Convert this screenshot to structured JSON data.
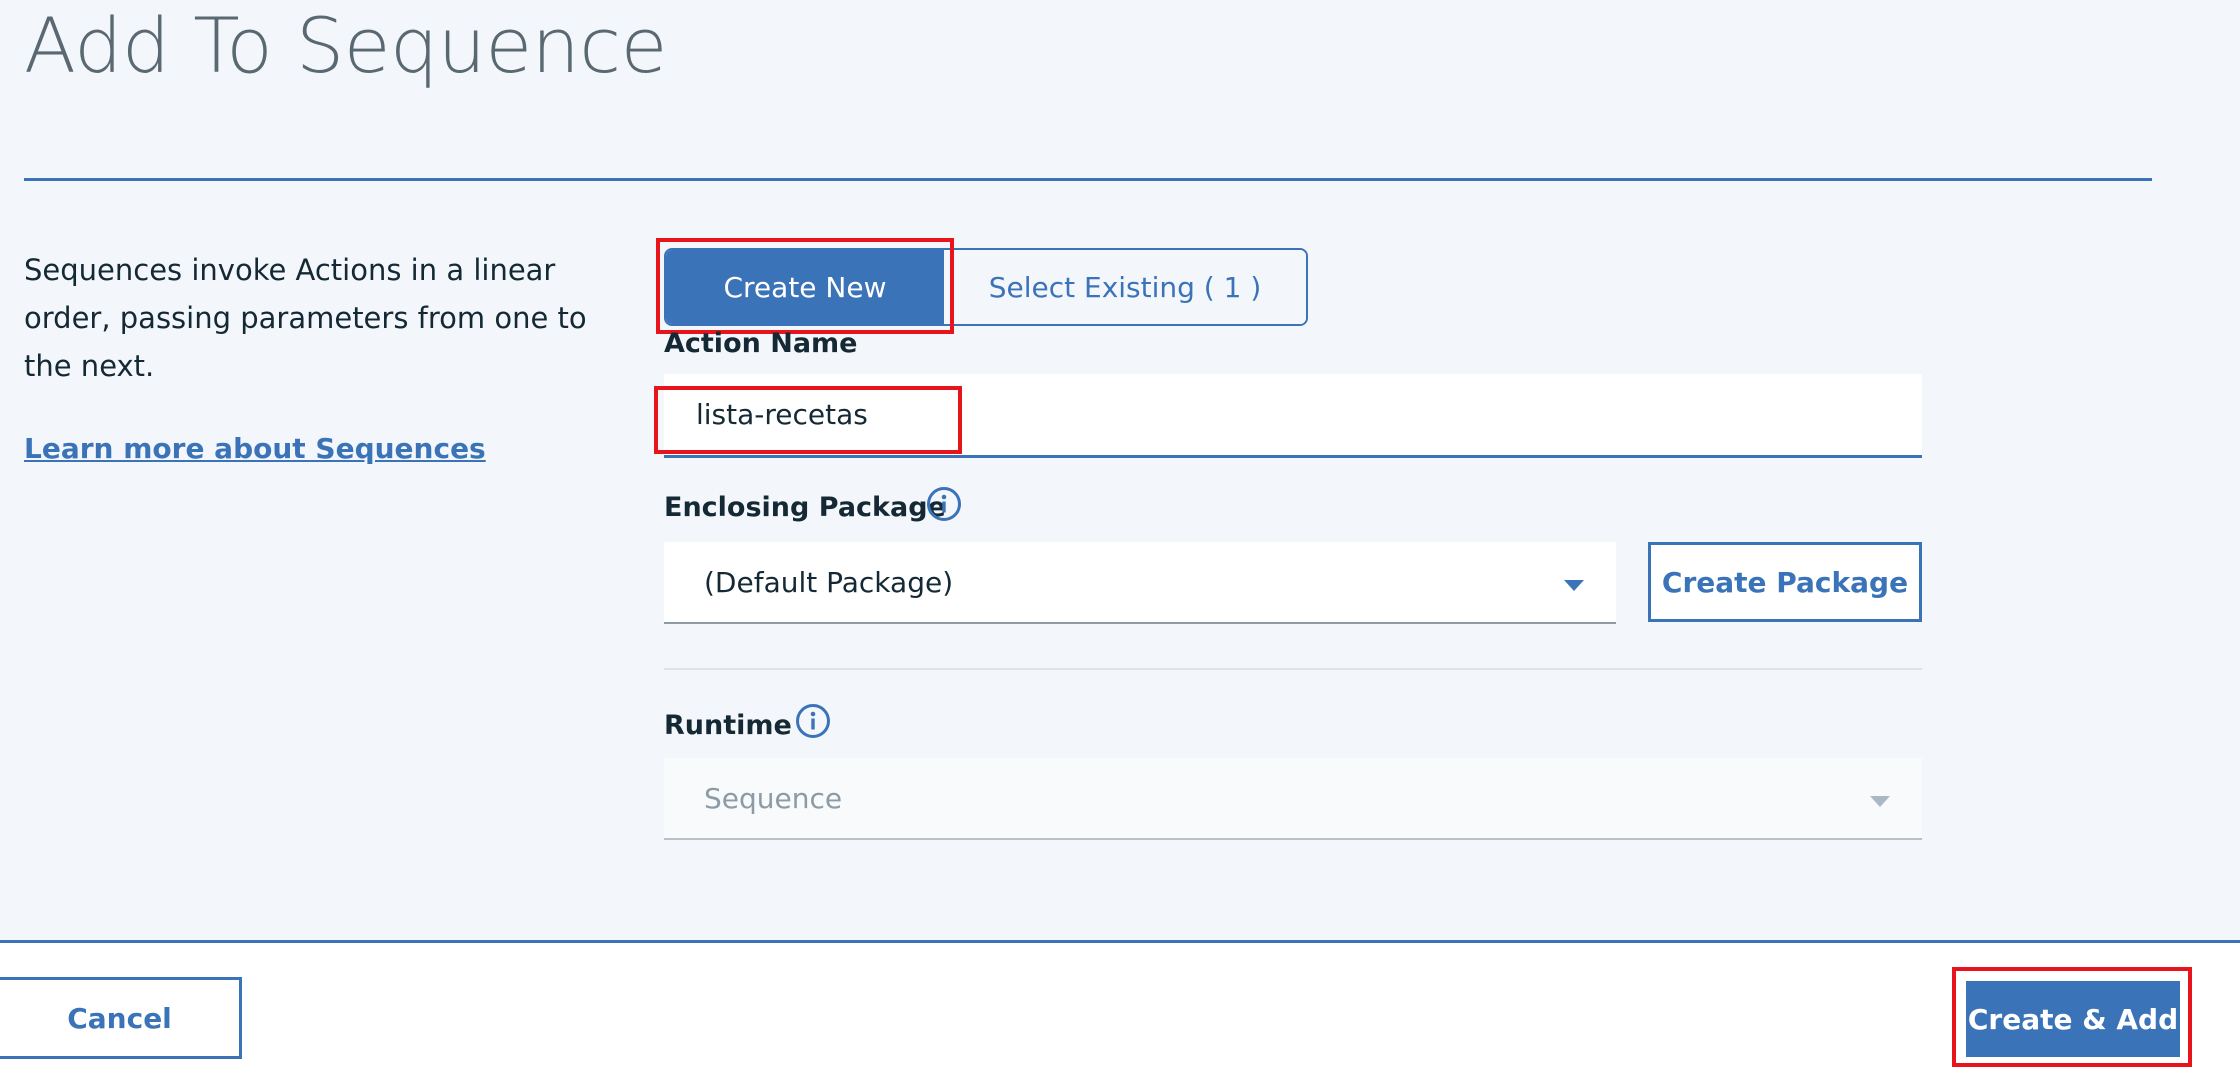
{
  "dialog": {
    "title": "Add To Sequence",
    "description": "Sequences invoke Actions in a linear order, passing parameters from one to the next.",
    "learn_more_link": "Learn more about Sequences"
  },
  "mode_toggle": {
    "options": [
      {
        "label": "Create New",
        "selected": true
      },
      {
        "label": "Select Existing ( 1 )",
        "selected": false
      }
    ]
  },
  "form": {
    "action_name": {
      "label": "Action Name",
      "value": "lista-recetas"
    },
    "enclosing_package": {
      "label": "Enclosing Package",
      "selected": "(Default Package)",
      "info_icon": "info-icon"
    },
    "create_package_button": "Create Package",
    "runtime": {
      "label": "Runtime",
      "selected": "Sequence",
      "disabled": true,
      "info_icon": "info-icon"
    }
  },
  "footer": {
    "cancel_label": "Cancel",
    "submit_label": "Create & Add"
  },
  "colors": {
    "accent": "#3b73b9",
    "background": "#f3f6fa",
    "highlight_box": "#e8141b"
  }
}
